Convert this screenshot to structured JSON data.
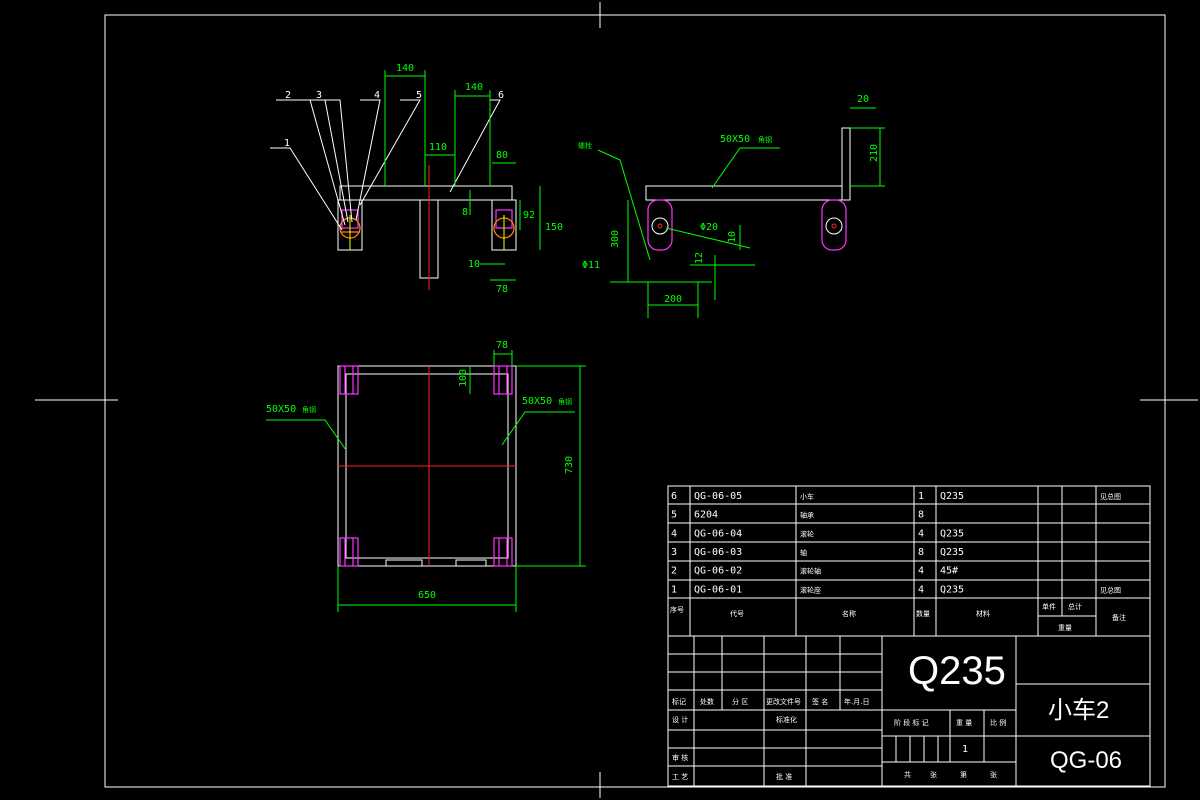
{
  "dimensions": {
    "d140a": "140",
    "d140b": "140",
    "d110": "110",
    "d80": "80",
    "d8": "8",
    "d92": "92",
    "d150": "150",
    "d10a": "10",
    "d78a": "78",
    "d20": "20",
    "d210": "210",
    "d300": "300",
    "d11": "Φ11",
    "d20dia": "Φ20",
    "d10b": "10",
    "d12": "12",
    "d200": "200",
    "d78b": "78",
    "d100": "100",
    "d730": "730",
    "d650": "650"
  },
  "labels": {
    "tube_side": "50X50",
    "tube_side_suffix": "角钢",
    "tube_plan_left": "50X50",
    "tube_plan_right": "50X50",
    "bolt_label": "螺栓"
  },
  "balloons": [
    "1",
    "2",
    "3",
    "4",
    "5",
    "6"
  ],
  "parts_list": [
    {
      "no": "6",
      "code": "QG-06-05",
      "name": "小车",
      "qty": "1",
      "material": "Q235",
      "note": "见总图"
    },
    {
      "no": "5",
      "code": "6204",
      "name": "轴承",
      "qty": "8",
      "material": "",
      "note": ""
    },
    {
      "no": "4",
      "code": "QG-06-04",
      "name": "滚轮",
      "qty": "4",
      "material": "Q235",
      "note": ""
    },
    {
      "no": "3",
      "code": "QG-06-03",
      "name": "轴",
      "qty": "8",
      "material": "Q235",
      "note": ""
    },
    {
      "no": "2",
      "code": "QG-06-02",
      "name": "滚轮轴",
      "qty": "4",
      "material": "45#",
      "note": ""
    },
    {
      "no": "1",
      "code": "QG-06-01",
      "name": "滚轮座",
      "qty": "4",
      "material": "Q235",
      "note": "见总图"
    }
  ],
  "parts_header": {
    "no": "序号",
    "code": "代号",
    "name": "名称",
    "qty": "数量",
    "material": "材料",
    "unit": "单件",
    "total": "总计",
    "weight": "重量",
    "note": "备注"
  },
  "title_block": {
    "material": "Q235",
    "part_name": "小车2",
    "drawing_no": "QG-06",
    "scale_value": "1",
    "row_labels": [
      "标记",
      "处数",
      "分 区",
      "更改文件号",
      "签 名",
      "年.月.日"
    ],
    "design": "设 计",
    "standard": "标准化",
    "review": "审 核",
    "craft": "工 艺",
    "approve": "批 准",
    "stage": "阶 段 标 记",
    "weight_lbl": "重 量",
    "scale_lbl": "比 例",
    "sheets": [
      "共",
      "张",
      "第",
      "张"
    ]
  }
}
